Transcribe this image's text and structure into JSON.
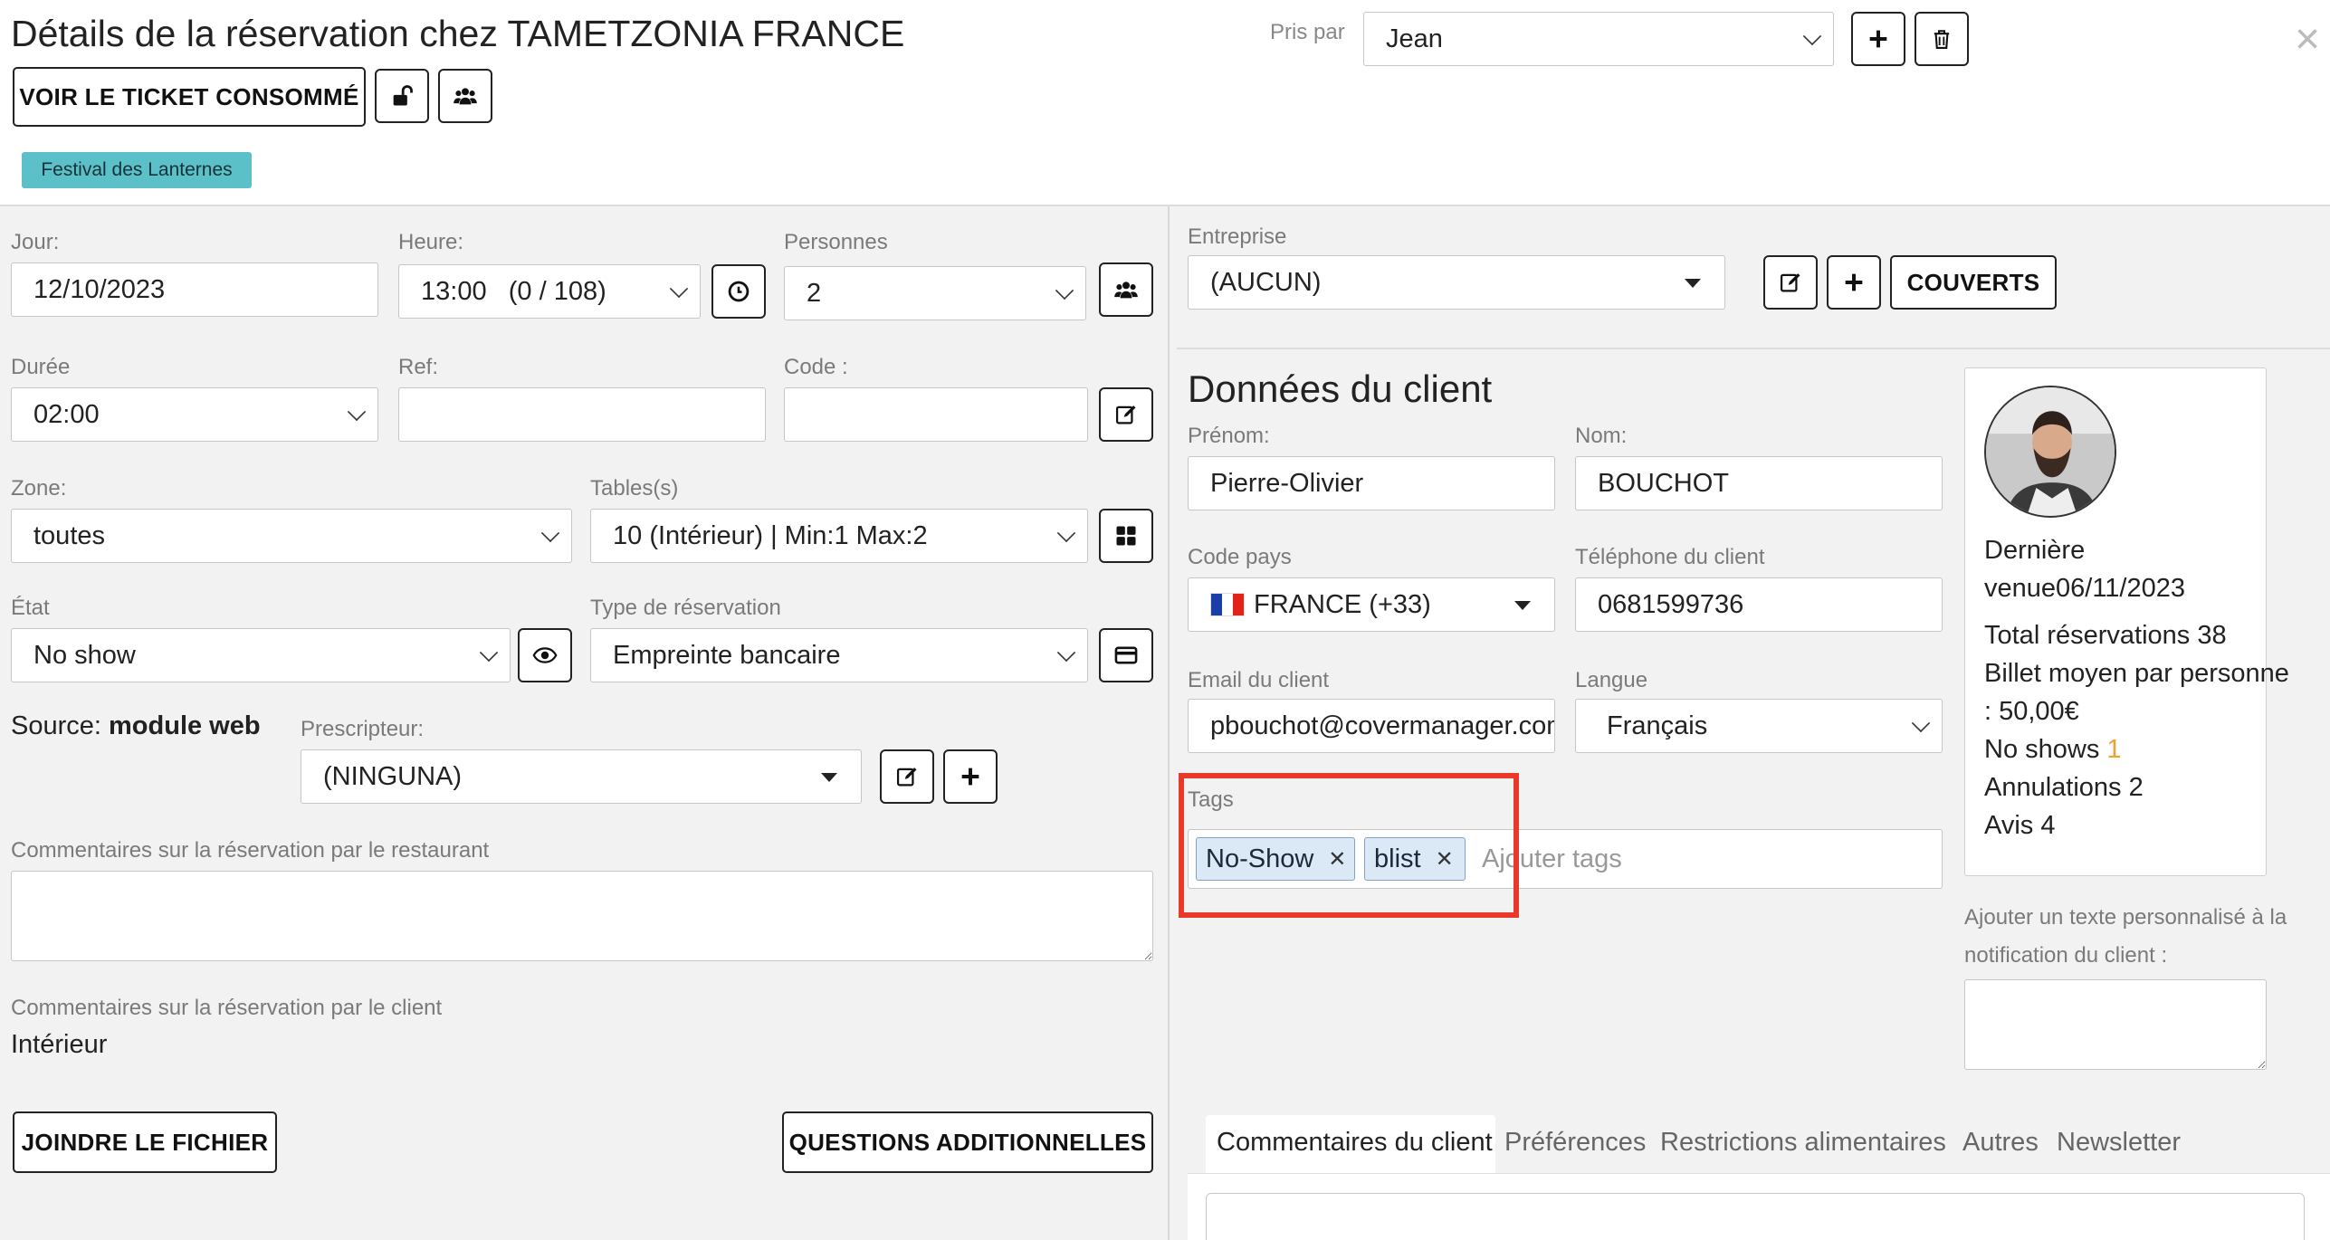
{
  "header": {
    "title": "Détails de la réservation chez TAMETZONIA FRANCE",
    "view_ticket_label": "VOIR LE TICKET CONSOMMÉ",
    "event_badge": "Festival des Lanternes",
    "taken_by_label": "Pris par",
    "taken_by_value": "Jean",
    "close_symbol": "×"
  },
  "booking": {
    "day_label": "Jour:",
    "day_value": "12/10/2023",
    "hour_label": "Heure:",
    "hour_value": "13:00   (0 / 108)",
    "people_label": "Personnes",
    "people_value": "2",
    "duration_label": "Durée",
    "duration_value": "02:00",
    "ref_label": "Ref:",
    "ref_value": "",
    "code_label": "Code :",
    "code_value": "",
    "zone_label": "Zone:",
    "zone_value": "toutes",
    "tables_label": "Tables(s)",
    "tables_value": "10 (Intérieur) | Min:1 Max:2",
    "state_label": "État",
    "state_value": "No show",
    "type_label": "Type de réservation",
    "type_value": "Empreinte bancaire",
    "source_label": "Source:",
    "source_value": "module web",
    "prescriber_label": "Prescripteur:",
    "prescriber_value": "(NINGUNA)",
    "restaurant_comments_label": "Commentaires sur la réservation par le restaurant",
    "restaurant_comments_value": "",
    "client_comments_label": "Commentaires sur la réservation par le client",
    "client_comments_value": "Intérieur",
    "attach_file_label": "JOINDRE LE FICHIER",
    "extra_questions_label": "QUESTIONS ADDITIONNELLES"
  },
  "company": {
    "label": "Entreprise",
    "value": "(AUCUN)",
    "covers_label": "COUVERTS"
  },
  "client": {
    "section_title": "Données du client",
    "first_name_label": "Prénom:",
    "first_name_value": "Pierre-Olivier",
    "last_name_label": "Nom:",
    "last_name_value": "BOUCHOT",
    "country_code_label": "Code pays",
    "country_code_value": "FRANCE (+33)",
    "phone_label": "Téléphone du client",
    "phone_value": "0681599736",
    "email_label": "Email du client",
    "email_value": "pbouchot@covermanager.com",
    "language_label": "Langue",
    "language_value": "Français",
    "tags_label": "Tags",
    "tags": [
      "No-Show",
      "blist"
    ],
    "tags_placeholder": "Ajouter tags",
    "highlight_color": "#e8392b"
  },
  "stats": {
    "last_visit_line1": "Dernière",
    "last_visit_line2": "venue06/11/2023",
    "total_reservations": "Total réservations 38",
    "avg_ticket_line1": "Billet moyen par personne",
    "avg_ticket_line2": ": 50,00€",
    "no_shows_label": "No shows",
    "no_shows_value": "1",
    "no_shows_color": "#f0a030",
    "cancellations": "Annulations 2",
    "reviews": "Avis 4"
  },
  "notification": {
    "label_line1": "Ajouter un texte personnalisé à la",
    "label_line2": "notification du client :",
    "value": ""
  },
  "tabs": [
    {
      "label": "Commentaires du client",
      "active": true
    },
    {
      "label": "Préférences",
      "active": false
    },
    {
      "label": "Restrictions alimentaires",
      "active": false
    },
    {
      "label": "Autres",
      "active": false
    },
    {
      "label": "Newsletter",
      "active": false
    }
  ]
}
